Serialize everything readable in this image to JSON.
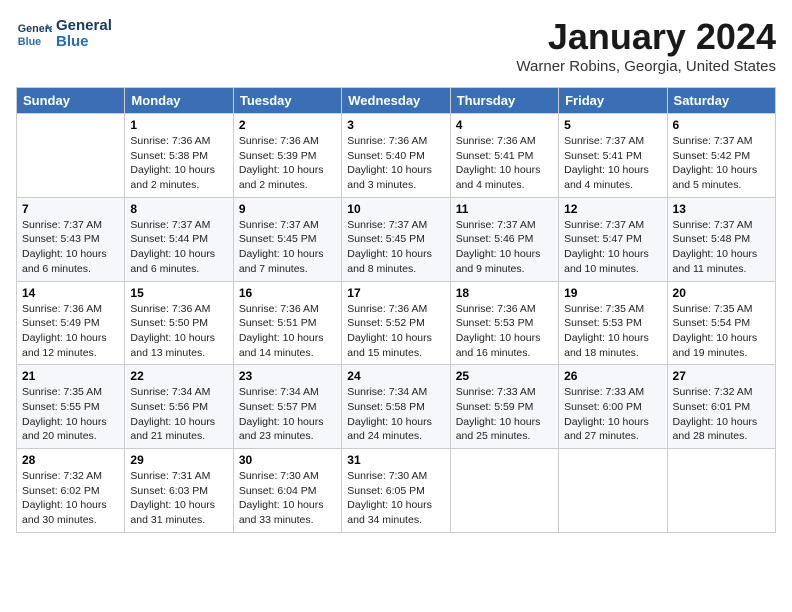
{
  "header": {
    "logo_line1": "General",
    "logo_line2": "Blue",
    "month": "January 2024",
    "location": "Warner Robins, Georgia, United States"
  },
  "weekdays": [
    "Sunday",
    "Monday",
    "Tuesday",
    "Wednesday",
    "Thursday",
    "Friday",
    "Saturday"
  ],
  "weeks": [
    [
      {
        "day": "",
        "info": ""
      },
      {
        "day": "1",
        "info": "Sunrise: 7:36 AM\nSunset: 5:38 PM\nDaylight: 10 hours\nand 2 minutes."
      },
      {
        "day": "2",
        "info": "Sunrise: 7:36 AM\nSunset: 5:39 PM\nDaylight: 10 hours\nand 2 minutes."
      },
      {
        "day": "3",
        "info": "Sunrise: 7:36 AM\nSunset: 5:40 PM\nDaylight: 10 hours\nand 3 minutes."
      },
      {
        "day": "4",
        "info": "Sunrise: 7:36 AM\nSunset: 5:41 PM\nDaylight: 10 hours\nand 4 minutes."
      },
      {
        "day": "5",
        "info": "Sunrise: 7:37 AM\nSunset: 5:41 PM\nDaylight: 10 hours\nand 4 minutes."
      },
      {
        "day": "6",
        "info": "Sunrise: 7:37 AM\nSunset: 5:42 PM\nDaylight: 10 hours\nand 5 minutes."
      }
    ],
    [
      {
        "day": "7",
        "info": "Sunrise: 7:37 AM\nSunset: 5:43 PM\nDaylight: 10 hours\nand 6 minutes."
      },
      {
        "day": "8",
        "info": "Sunrise: 7:37 AM\nSunset: 5:44 PM\nDaylight: 10 hours\nand 6 minutes."
      },
      {
        "day": "9",
        "info": "Sunrise: 7:37 AM\nSunset: 5:45 PM\nDaylight: 10 hours\nand 7 minutes."
      },
      {
        "day": "10",
        "info": "Sunrise: 7:37 AM\nSunset: 5:45 PM\nDaylight: 10 hours\nand 8 minutes."
      },
      {
        "day": "11",
        "info": "Sunrise: 7:37 AM\nSunset: 5:46 PM\nDaylight: 10 hours\nand 9 minutes."
      },
      {
        "day": "12",
        "info": "Sunrise: 7:37 AM\nSunset: 5:47 PM\nDaylight: 10 hours\nand 10 minutes."
      },
      {
        "day": "13",
        "info": "Sunrise: 7:37 AM\nSunset: 5:48 PM\nDaylight: 10 hours\nand 11 minutes."
      }
    ],
    [
      {
        "day": "14",
        "info": "Sunrise: 7:36 AM\nSunset: 5:49 PM\nDaylight: 10 hours\nand 12 minutes."
      },
      {
        "day": "15",
        "info": "Sunrise: 7:36 AM\nSunset: 5:50 PM\nDaylight: 10 hours\nand 13 minutes."
      },
      {
        "day": "16",
        "info": "Sunrise: 7:36 AM\nSunset: 5:51 PM\nDaylight: 10 hours\nand 14 minutes."
      },
      {
        "day": "17",
        "info": "Sunrise: 7:36 AM\nSunset: 5:52 PM\nDaylight: 10 hours\nand 15 minutes."
      },
      {
        "day": "18",
        "info": "Sunrise: 7:36 AM\nSunset: 5:53 PM\nDaylight: 10 hours\nand 16 minutes."
      },
      {
        "day": "19",
        "info": "Sunrise: 7:35 AM\nSunset: 5:53 PM\nDaylight: 10 hours\nand 18 minutes."
      },
      {
        "day": "20",
        "info": "Sunrise: 7:35 AM\nSunset: 5:54 PM\nDaylight: 10 hours\nand 19 minutes."
      }
    ],
    [
      {
        "day": "21",
        "info": "Sunrise: 7:35 AM\nSunset: 5:55 PM\nDaylight: 10 hours\nand 20 minutes."
      },
      {
        "day": "22",
        "info": "Sunrise: 7:34 AM\nSunset: 5:56 PM\nDaylight: 10 hours\nand 21 minutes."
      },
      {
        "day": "23",
        "info": "Sunrise: 7:34 AM\nSunset: 5:57 PM\nDaylight: 10 hours\nand 23 minutes."
      },
      {
        "day": "24",
        "info": "Sunrise: 7:34 AM\nSunset: 5:58 PM\nDaylight: 10 hours\nand 24 minutes."
      },
      {
        "day": "25",
        "info": "Sunrise: 7:33 AM\nSunset: 5:59 PM\nDaylight: 10 hours\nand 25 minutes."
      },
      {
        "day": "26",
        "info": "Sunrise: 7:33 AM\nSunset: 6:00 PM\nDaylight: 10 hours\nand 27 minutes."
      },
      {
        "day": "27",
        "info": "Sunrise: 7:32 AM\nSunset: 6:01 PM\nDaylight: 10 hours\nand 28 minutes."
      }
    ],
    [
      {
        "day": "28",
        "info": "Sunrise: 7:32 AM\nSunset: 6:02 PM\nDaylight: 10 hours\nand 30 minutes."
      },
      {
        "day": "29",
        "info": "Sunrise: 7:31 AM\nSunset: 6:03 PM\nDaylight: 10 hours\nand 31 minutes."
      },
      {
        "day": "30",
        "info": "Sunrise: 7:30 AM\nSunset: 6:04 PM\nDaylight: 10 hours\nand 33 minutes."
      },
      {
        "day": "31",
        "info": "Sunrise: 7:30 AM\nSunset: 6:05 PM\nDaylight: 10 hours\nand 34 minutes."
      },
      {
        "day": "",
        "info": ""
      },
      {
        "day": "",
        "info": ""
      },
      {
        "day": "",
        "info": ""
      }
    ]
  ]
}
